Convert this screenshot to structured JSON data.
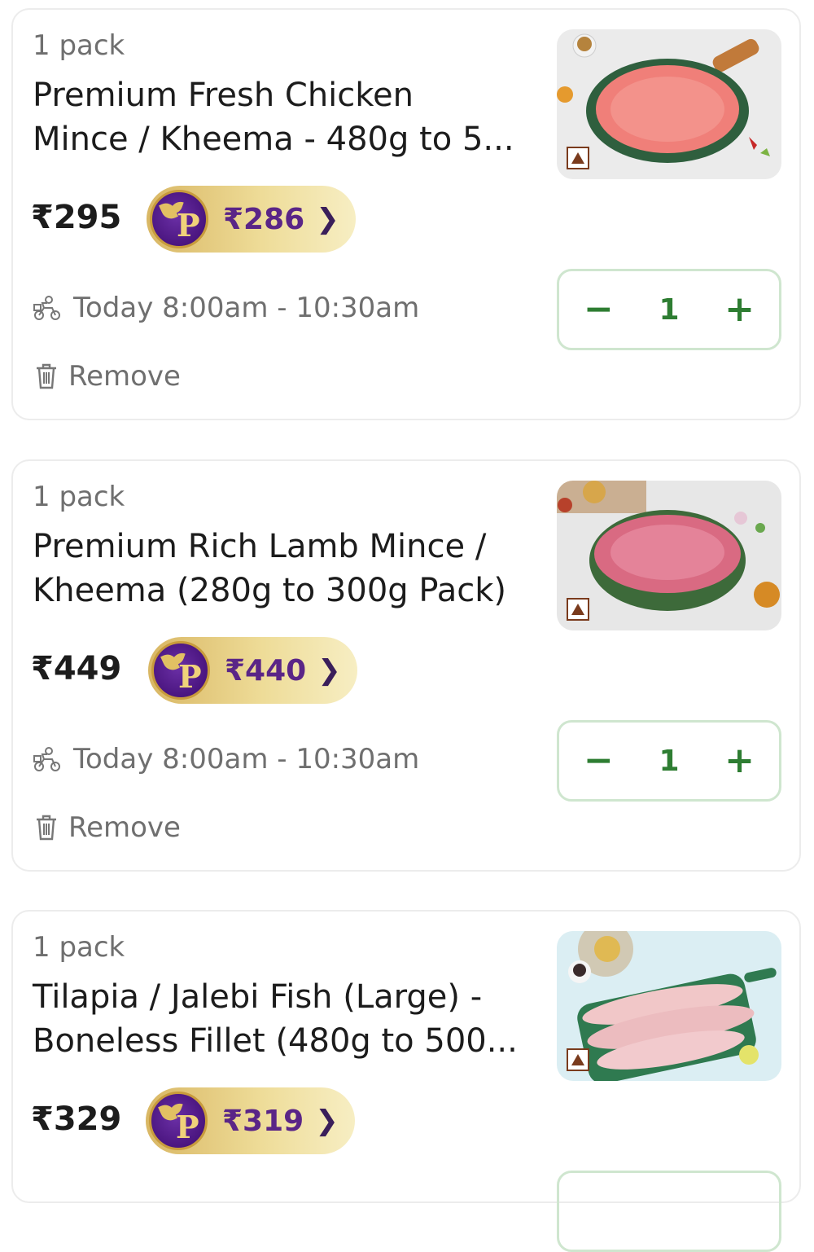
{
  "cart_items": [
    {
      "pack": "1 pack",
      "title_line1": "Premium Fresh Chicken",
      "title_line2": "Mince / Kheema - 480g to 5...",
      "price": "₹295",
      "member_price": "₹286",
      "delivery": "Today 8:00am - 10:30am",
      "remove_label": "Remove",
      "quantity": "1",
      "decrease_label": "−",
      "increase_label": "+"
    },
    {
      "pack": "1 pack",
      "title_line1": "Premium Rich Lamb Mince /",
      "title_line2": "Kheema (280g to 300g Pack)",
      "price": "₹449",
      "member_price": "₹440",
      "delivery": "Today 8:00am - 10:30am",
      "remove_label": "Remove",
      "quantity": "1",
      "decrease_label": "−",
      "increase_label": "+"
    },
    {
      "pack": "1 pack",
      "title_line1": "Tilapia / Jalebi Fish (Large) -",
      "title_line2": "Boneless Fillet (480g to 500...",
      "price": "₹329",
      "member_price": "₹319",
      "delivery": "",
      "remove_label": "",
      "quantity": "",
      "decrease_label": "",
      "increase_label": ""
    }
  ],
  "colors": {
    "accent_green": "#2e7d32",
    "member_purple": "#5a2587",
    "member_gold": "#e2c063",
    "nonveg_mark": "#7a3b1d"
  },
  "icons": [
    "delivery-scooter-icon",
    "trash-icon",
    "nonveg-mark-icon",
    "chevron-right-icon",
    "member-p-badge-icon"
  ]
}
